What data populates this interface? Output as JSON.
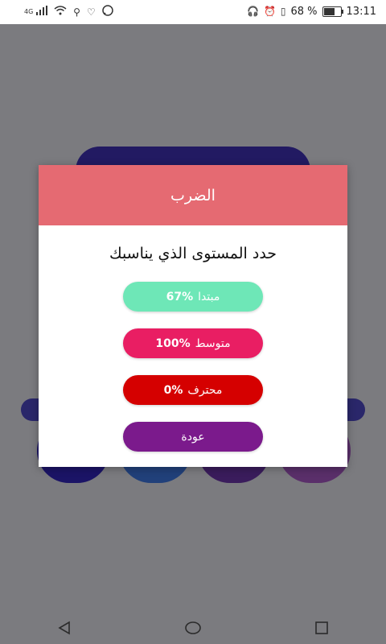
{
  "status_bar": {
    "network": "4G",
    "battery_percent": "68 %",
    "battery_level": 0.68,
    "time": "13:11",
    "icons_left": [
      "signal-icon",
      "wifi-icon",
      "usb-icon",
      "health-icon",
      "whatsapp-icon"
    ],
    "icons_right": [
      "headset-icon",
      "alarm-icon",
      "vibrate-icon"
    ]
  },
  "dialog": {
    "title": "الضرب",
    "question": "حدد المستوى الذي يناسبك",
    "buttons": [
      {
        "label": "مبتدا",
        "percent": "67%",
        "color": "#6ee7b7"
      },
      {
        "label": "متوسط",
        "percent": "100%",
        "color": "#e91e63"
      },
      {
        "label": "محترف",
        "percent": "0%",
        "color": "#d50000"
      },
      {
        "label": "عودة",
        "percent": "",
        "color": "#7b1a8c"
      }
    ]
  },
  "nav_bar": {
    "items": [
      "back-icon",
      "home-icon",
      "recents-icon"
    ]
  }
}
